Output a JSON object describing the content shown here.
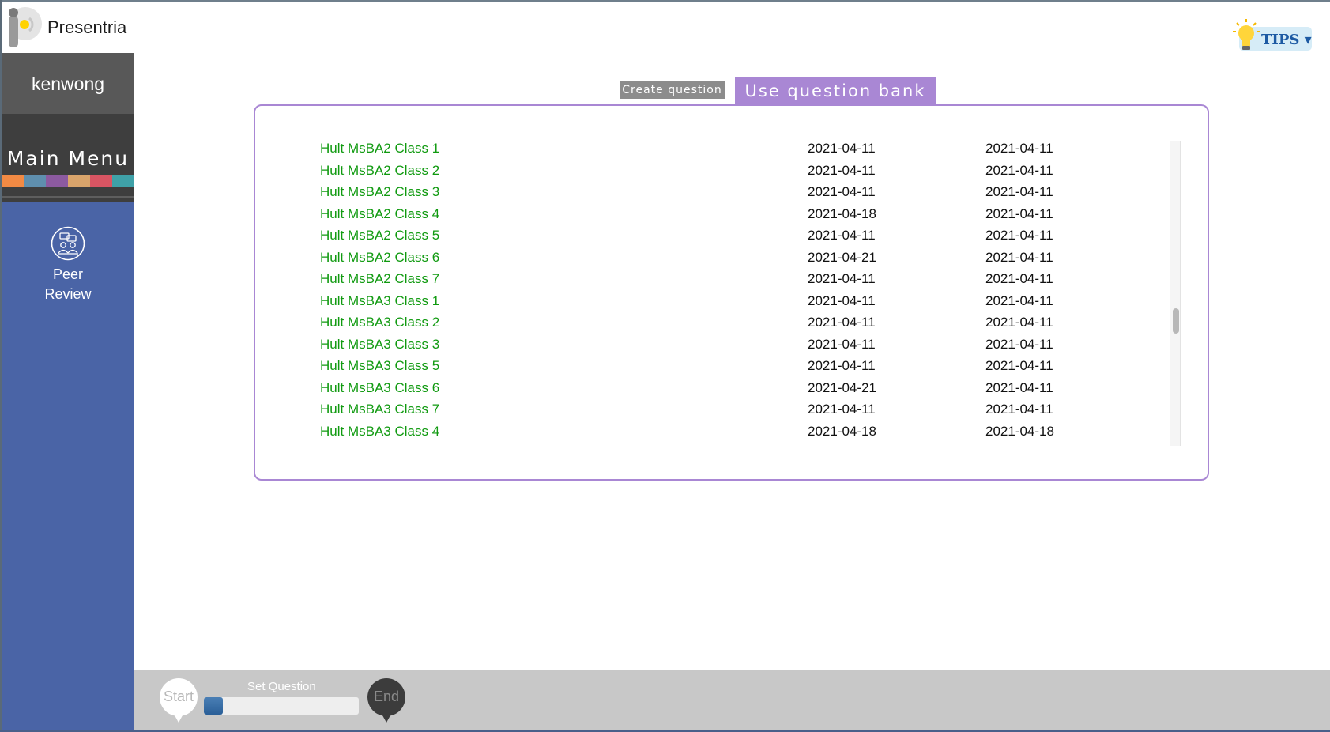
{
  "app": {
    "brand": "Presentria"
  },
  "user": {
    "name": "kenwong"
  },
  "menu": {
    "label": "Main Menu",
    "strip_colors": [
      "#f28a44",
      "#5f8fae",
      "#8c5aa0",
      "#d9a46b",
      "#d95563",
      "#3fa1a8"
    ]
  },
  "sidebar": {
    "items": [
      {
        "label_line1": "Peer",
        "label_line2": "Review",
        "icon": "peer-review-icon"
      }
    ]
  },
  "tips": {
    "label": "TIPS ▾",
    "icon": "lightbulb-icon"
  },
  "tabs": [
    {
      "label": "Create question",
      "active": false
    },
    {
      "label": "Use question bank",
      "active": true
    }
  ],
  "bank": {
    "rows": [
      {
        "name": "Hult MsBA2 Class 1",
        "date1": "2021-04-11",
        "date2": "2021-04-11"
      },
      {
        "name": "Hult MsBA2 Class 2",
        "date1": "2021-04-11",
        "date2": "2021-04-11"
      },
      {
        "name": "Hult MsBA2 Class 3",
        "date1": "2021-04-11",
        "date2": "2021-04-11"
      },
      {
        "name": "Hult MsBA2 Class 4",
        "date1": "2021-04-18",
        "date2": "2021-04-11"
      },
      {
        "name": "Hult MsBA2 Class 5",
        "date1": "2021-04-11",
        "date2": "2021-04-11"
      },
      {
        "name": "Hult MsBA2 Class 6",
        "date1": "2021-04-21",
        "date2": "2021-04-11"
      },
      {
        "name": "Hult MsBA2 Class 7",
        "date1": "2021-04-11",
        "date2": "2021-04-11"
      },
      {
        "name": "Hult MsBA3 Class 1",
        "date1": "2021-04-11",
        "date2": "2021-04-11"
      },
      {
        "name": "Hult MsBA3 Class 2",
        "date1": "2021-04-11",
        "date2": "2021-04-11"
      },
      {
        "name": "Hult MsBA3 Class 3",
        "date1": "2021-04-11",
        "date2": "2021-04-11"
      },
      {
        "name": "Hult MsBA3 Class 5",
        "date1": "2021-04-11",
        "date2": "2021-04-11"
      },
      {
        "name": "Hult MsBA3 Class 6",
        "date1": "2021-04-21",
        "date2": "2021-04-11"
      },
      {
        "name": "Hult MsBA3 Class 7",
        "date1": "2021-04-11",
        "date2": "2021-04-11"
      },
      {
        "name": "Hult MsBA3 Class 4",
        "date1": "2021-04-18",
        "date2": "2021-04-18"
      }
    ]
  },
  "progress": {
    "start_label": "Start",
    "end_label": "End",
    "step_label": "Set Question",
    "fraction": 0.12
  }
}
